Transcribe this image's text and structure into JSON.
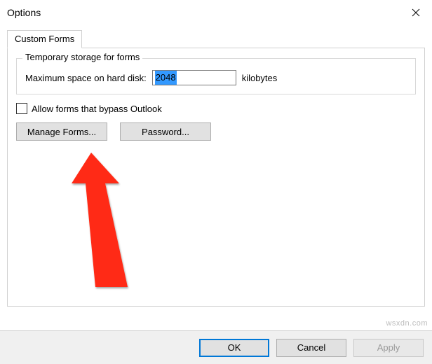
{
  "window": {
    "title": "Options"
  },
  "tab": {
    "label": "Custom Forms"
  },
  "group": {
    "legend": "Temporary storage for forms",
    "max_space_label": "Maximum space on hard disk:",
    "max_space_value": "2048",
    "unit": "kilobytes"
  },
  "checkbox": {
    "label": "Allow forms that bypass Outlook",
    "checked": false
  },
  "buttons": {
    "manage_forms": "Manage Forms...",
    "password": "Password..."
  },
  "footer": {
    "ok": "OK",
    "cancel": "Cancel",
    "apply": "Apply"
  },
  "watermark": "wsxdn.com"
}
